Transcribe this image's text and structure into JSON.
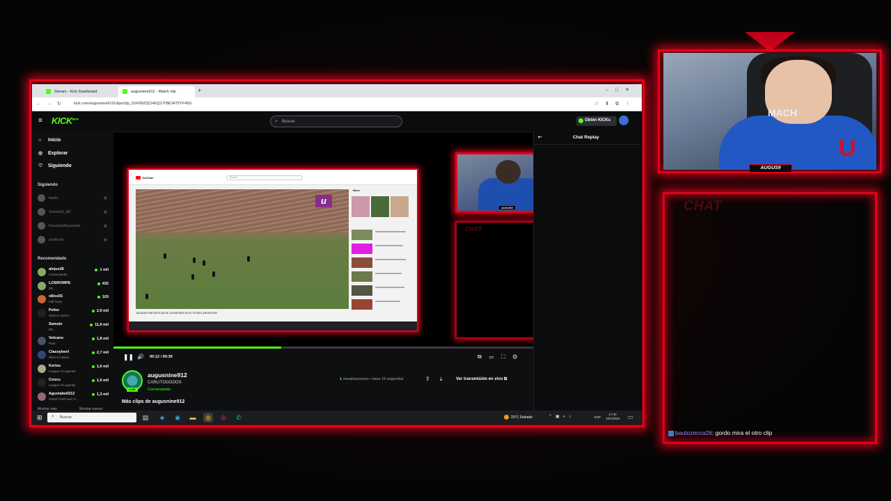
{
  "browser": {
    "tabs": [
      {
        "label": "Stream - Kick Dashboard"
      },
      {
        "label": "augusnine912 - Watch clip"
      }
    ],
    "url": "kick.com/augusnine912/clips/clip_01KFBZQCHKQ2JTBE3475YF45G"
  },
  "kick": {
    "logo": "KICK",
    "logo_sup": "BETA",
    "search_placeholder": "Buscar",
    "get_kicks": "Obtén KICKs",
    "nav": [
      {
        "label": "Inicio",
        "icon": "home-icon"
      },
      {
        "label": "Explorar",
        "icon": "compass-icon"
      },
      {
        "label": "Siguiendo",
        "icon": "heart-icon"
      }
    ],
    "following_title": "Siguiendo",
    "following": [
      "baulo",
      "SoinsHD_88",
      "FacundoNavarrete",
      "santicchi"
    ],
    "recommended_title": "Recomendado",
    "recommended": [
      {
        "name": "alejus28",
        "category": "Conversando",
        "viewers": "1 mil"
      },
      {
        "name": "LOSROMPE",
        "category": "IRL",
        "viewers": "432"
      },
      {
        "name": "x8ixs55",
        "category": "Fall Guys",
        "viewers": "103"
      },
      {
        "name": "Pelter",
        "category": "Slots & Casino",
        "viewers": "2,9 mil"
      },
      {
        "name": "Samulx",
        "category": "IRL",
        "viewers": "11,9 mil"
      },
      {
        "name": "Volcano",
        "category": "Rust",
        "viewers": "1,8 mil"
      },
      {
        "name": "Classybeef",
        "category": "Slots & Casino",
        "viewers": "2,7 mil"
      },
      {
        "name": "Kerlos",
        "category": "League of Legends",
        "viewers": "1,6 mil"
      },
      {
        "name": "Coscu",
        "category": "League of Legends",
        "viewers": "1,5 mil"
      },
      {
        "name": "Agustabell212",
        "category": "Grand Theft Auto V...",
        "viewers": "1,3 mil"
      }
    ],
    "show_more": "Mostrar más",
    "show_less": "Mostrar menos",
    "player": {
      "time": "00:12 / 00:30",
      "progress": 0.4
    },
    "channel": {
      "name": "augusnine912",
      "title": "CARLITOOOOOS",
      "category": "Conversando",
      "live_badge": "LIVE",
      "views_count": "1",
      "views_label": "visualizaciones",
      "time_ago": "• hace 15 segundos",
      "watch_live": "Ver transmisión en vivo ⧉"
    },
    "more_clips": "Más clips de augusnine912",
    "chat_replay": "Chat Replay"
  },
  "inner_stream": {
    "yt_logo": "YouTube",
    "yt_search": "Buscar",
    "video_title": "JUGADAS FANTÁSTICAS DE JUGADORES EN EL FÚTBOL ARGENTINO",
    "side_heading": "Mixes",
    "webcam_tag": "AUGUS9",
    "chat_label": "CHAT"
  },
  "taskbar": {
    "search_placeholder": "Buscar",
    "weather": "23°C Soleado",
    "lang": "ESP",
    "time": "17:40",
    "date": "16/1/2026"
  },
  "overlay": {
    "webcam_tag": "AUGUS9",
    "webcam_shirt": "MACH",
    "chat_label": "CHAT",
    "chat_message": {
      "user": "bautozecca26",
      "text": ": gordo mira el otro clip"
    }
  },
  "colors": {
    "accent": "#53fc18",
    "frame": "#e3001b"
  }
}
